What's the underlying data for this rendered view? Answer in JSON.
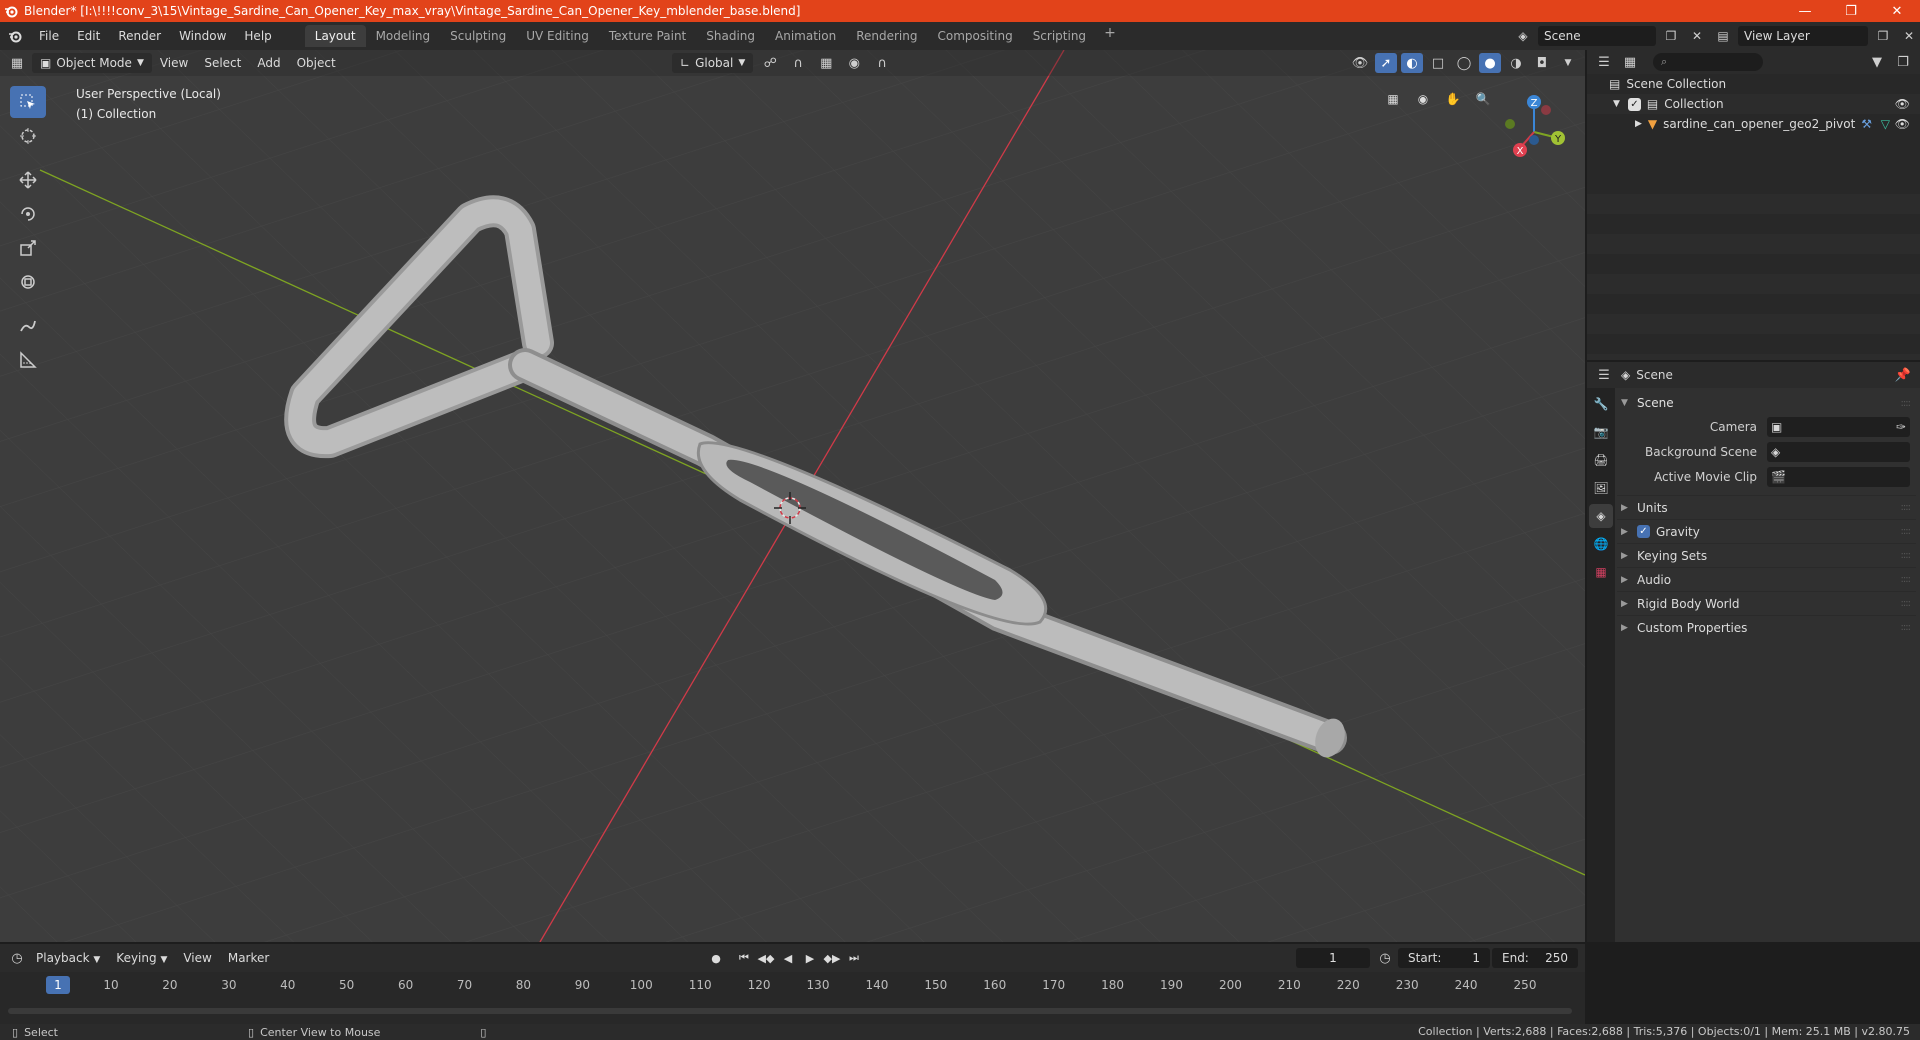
{
  "window": {
    "title": "Blender* [I:\\!!!!conv_3\\15\\Vintage_Sardine_Can_Opener_Key_max_vray\\Vintage_Sardine_Can_Opener_Key_mblender_base.blend]"
  },
  "menu": [
    "File",
    "Edit",
    "Render",
    "Window",
    "Help"
  ],
  "workspaces": [
    "Layout",
    "Modeling",
    "Sculpting",
    "UV Editing",
    "Texture Paint",
    "Shading",
    "Animation",
    "Rendering",
    "Compositing",
    "Scripting"
  ],
  "active_workspace": "Layout",
  "scene_field": "Scene",
  "view_layer_field": "View Layer",
  "viewport": {
    "mode": "Object Mode",
    "menus": [
      "View",
      "Select",
      "Add",
      "Object"
    ],
    "transform_orientation": "Global",
    "info_line1": "User Perspective (Local)",
    "info_line2": "(1) Collection",
    "gizmo_axes": {
      "x": "X",
      "y": "Y",
      "z": "Z"
    },
    "colors": {
      "background": "#3d3d3d",
      "x_axis": "#d03a48",
      "y_axis": "#7ea422",
      "z_axis": "#3b86d6",
      "object": "#b5b5b5"
    }
  },
  "outliner": {
    "root": "Scene Collection",
    "collection": "Collection",
    "object": "sardine_can_opener_geo2_pivot"
  },
  "properties": {
    "header_title": "Scene",
    "panel_title": "Scene",
    "rows": [
      {
        "label": "Camera"
      },
      {
        "label": "Background Scene"
      },
      {
        "label": "Active Movie Clip"
      }
    ],
    "subpanels": [
      "Units",
      "Gravity",
      "Keying Sets",
      "Audio",
      "Rigid Body World",
      "Custom Properties"
    ]
  },
  "timeline": {
    "menus": [
      "Playback",
      "Keying",
      "View",
      "Marker"
    ],
    "current_frame": "1",
    "start_label": "Start:",
    "start_value": "1",
    "end_label": "End:",
    "end_value": "250",
    "ticks": [
      "1",
      "10",
      "20",
      "30",
      "40",
      "50",
      "60",
      "70",
      "80",
      "90",
      "100",
      "110",
      "120",
      "130",
      "140",
      "150",
      "160",
      "170",
      "180",
      "190",
      "200",
      "210",
      "220",
      "230",
      "240",
      "250"
    ]
  },
  "statusbar": {
    "left_action": "Select",
    "middle_action": "Center View to Mouse",
    "stats": "Collection | Verts:2,688 | Faces:2,688 | Tris:5,376 | Objects:0/1 | Mem: 25.1 MB | v2.80.75"
  }
}
